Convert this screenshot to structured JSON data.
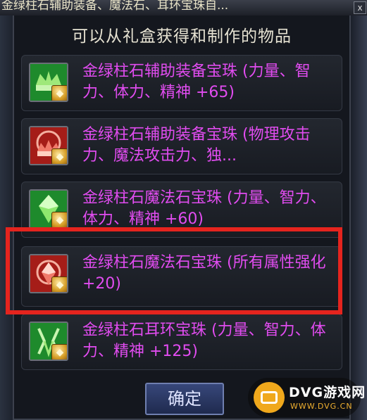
{
  "window": {
    "title": "金绿柱石辅助装备、魔法石、耳环宝珠自...",
    "close_label": "x"
  },
  "dialog": {
    "header": "可以从礼盒获得和制作的物品",
    "items": [
      {
        "label": "金绿柱石辅助装备宝珠 (力量、智力、体力、精神 +65)",
        "icon": "green-crown-gem-icon",
        "color": "#2aa838"
      },
      {
        "label": "金绿柱石辅助装备宝珠 (物理攻击力、魔法攻击力、独...",
        "icon": "red-crown-gem-icon",
        "color": "#c2261e"
      },
      {
        "label": "金绿柱石魔法石宝珠 (力量、智力、体力、精神 +60)",
        "icon": "green-crystal-gem-icon",
        "color": "#2aa838"
      },
      {
        "label": "金绿柱石魔法石宝珠 (所有属性强化 +20)",
        "icon": "red-crystal-gem-icon",
        "color": "#c2261e"
      },
      {
        "label": "金绿柱石耳环宝珠 (力量、智力、体力、精神 +125)",
        "icon": "green-earring-gem-icon",
        "color": "#2aa838"
      }
    ],
    "confirm_label": "确定",
    "highlight_color": "#e5241e",
    "item_text_color": "#e14cf0"
  },
  "watermark": {
    "brand": "DVG游戏网",
    "url": "WWW.DVG.CN"
  }
}
